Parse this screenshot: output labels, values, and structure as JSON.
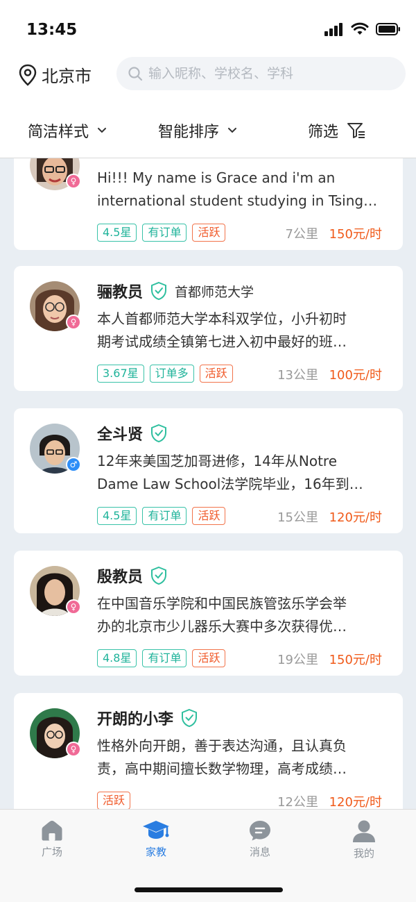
{
  "status_bar": {
    "time": "13:45"
  },
  "header": {
    "location": "北京市",
    "search": {
      "placeholder": "输入昵称、学校名、学科",
      "value": ""
    }
  },
  "filters": [
    {
      "label": "简洁样式",
      "icon": "chevron-down-icon"
    },
    {
      "label": "智能排序",
      "icon": "chevron-down-icon"
    },
    {
      "label": "筛选",
      "icon": "filter-icon"
    }
  ],
  "cards": [
    {
      "name": "",
      "school": "",
      "gender": "female",
      "desc": [
        "Hi!!! My name is Grace and i'm an",
        "international student studying in Tsing…"
      ],
      "tags": [
        {
          "text": "4.5星",
          "style": "green"
        },
        {
          "text": "有订单",
          "style": "green"
        },
        {
          "text": "活跃",
          "style": "orange"
        }
      ],
      "distance": "7公里",
      "price": "150元/时"
    },
    {
      "name": "骊教员",
      "school": "首都师范大学",
      "gender": "female",
      "desc": [
        "本人首都师范大学本科双学位，小升初时",
        "期考试成绩全镇第七进入初中最好的班…"
      ],
      "tags": [
        {
          "text": "3.67星",
          "style": "green"
        },
        {
          "text": "订单多",
          "style": "green"
        },
        {
          "text": "活跃",
          "style": "orange"
        }
      ],
      "distance": "13公里",
      "price": "100元/时"
    },
    {
      "name": "全斗贤",
      "school": "",
      "gender": "male",
      "desc": [
        "12年来美国芝加哥进修，14年从Notre",
        "Dame Law School法学院毕业，16年到…"
      ],
      "tags": [
        {
          "text": "4.5星",
          "style": "green"
        },
        {
          "text": "有订单",
          "style": "green"
        },
        {
          "text": "活跃",
          "style": "orange"
        }
      ],
      "distance": "15公里",
      "price": "120元/时"
    },
    {
      "name": "殷教员",
      "school": "",
      "gender": "female",
      "desc": [
        "在中国音乐学院和中国民族管弦乐学会举",
        "办的北京市少儿器乐大赛中多次获得优…"
      ],
      "tags": [
        {
          "text": "4.8星",
          "style": "green"
        },
        {
          "text": "有订单",
          "style": "green"
        },
        {
          "text": "活跃",
          "style": "orange"
        }
      ],
      "distance": "19公里",
      "price": "150元/时"
    },
    {
      "name": "开朗的小李",
      "school": "",
      "gender": "female",
      "desc": [
        "性格外向开朗，善于表达沟通，且认真负",
        "责，高中期间擅长数学物理，高考成绩…"
      ],
      "tags": [
        {
          "text": "活跃",
          "style": "orange"
        }
      ],
      "distance": "12公里",
      "price": "120元/时"
    }
  ],
  "tabbar": [
    {
      "label": "广场",
      "icon": "home-icon",
      "active": false
    },
    {
      "label": "家教",
      "icon": "graduation-cap-icon",
      "active": true
    },
    {
      "label": "消息",
      "icon": "message-icon",
      "active": false
    },
    {
      "label": "我的",
      "icon": "user-icon",
      "active": false
    }
  ],
  "colors": {
    "accent": "#2a7de1",
    "tag_green": "#1fb39a",
    "tag_orange": "#f05a2a",
    "price": "#f05a1a",
    "background": "#e9eef3"
  }
}
